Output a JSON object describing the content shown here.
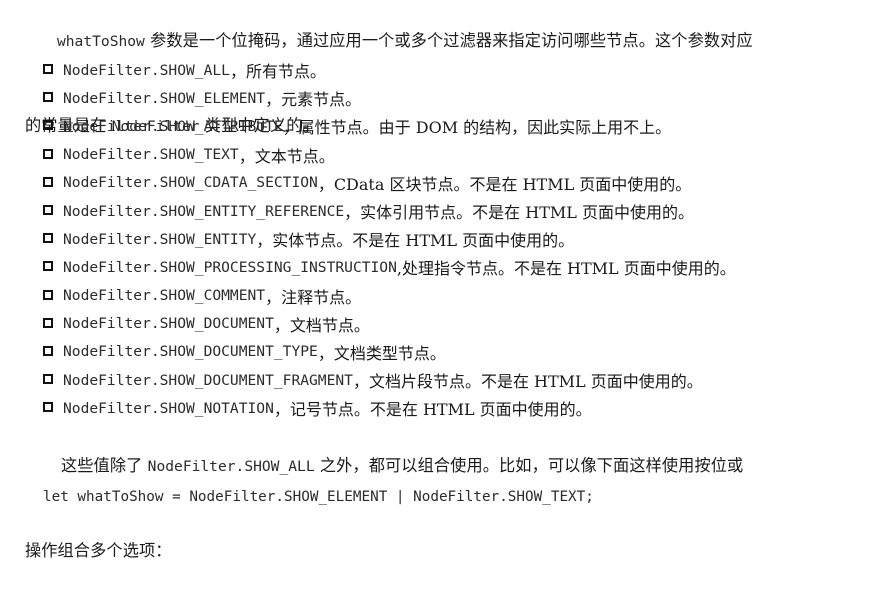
{
  "intro": {
    "code": "whatToShow",
    "text1": " 参数是一个位掩码，通过应用一个或多个过滤器来指定访问哪些节点。这个参数对应",
    "text2": "的常量是在 ",
    "code2": "NodeFilter",
    "text3": " 类型中定义的。"
  },
  "items": [
    {
      "code": "NodeFilter.SHOW_ALL",
      "text": "，所有节点。"
    },
    {
      "code": "NodeFilter.SHOW_ELEMENT",
      "text": "，元素节点。"
    },
    {
      "code": "NodeFilter.SHOW_ATTRIBUTE",
      "text": "，属性节点。由于 DOM 的结构，因此实际上用不上。"
    },
    {
      "code": "NodeFilter.SHOW_TEXT",
      "text": "，文本节点。"
    },
    {
      "code": "NodeFilter.SHOW_CDATA_SECTION",
      "text": "，CData 区块节点。不是在 HTML 页面中使用的。"
    },
    {
      "code": "NodeFilter.SHOW_ENTITY_REFERENCE",
      "text": "，实体引用节点。不是在 HTML 页面中使用的。"
    },
    {
      "code": "NodeFilter.SHOW_ENTITY",
      "text": "，实体节点。不是在 HTML 页面中使用的。"
    },
    {
      "code": "NodeFilter.SHOW_PROCESSING_INSTRUCTION",
      "text": ",处理指令节点。不是在 HTML 页面中使用的。"
    },
    {
      "code": "NodeFilter.SHOW_COMMENT",
      "text": "，注释节点。"
    },
    {
      "code": "NodeFilter.SHOW_DOCUMENT",
      "text": "，文档节点。"
    },
    {
      "code": "NodeFilter.SHOW_DOCUMENT_TYPE",
      "text": "，文档类型节点。"
    },
    {
      "code": "NodeFilter.SHOW_DOCUMENT_FRAGMENT",
      "text": "，文档片段节点。不是在 HTML 页面中使用的。"
    },
    {
      "code": "NodeFilter.SHOW_NOTATION",
      "text": "，记号节点。不是在 HTML 页面中使用的。"
    }
  ],
  "outro": {
    "text1": "这些值除了 ",
    "code": "NodeFilter.SHOW_ALL",
    "text2": " 之外，都可以组合使用。比如，可以像下面这样使用按位或",
    "text3": "操作组合多个选项："
  },
  "code_line": "let whatToShow = NodeFilter.SHOW_ELEMENT | NodeFilter.SHOW_TEXT;"
}
